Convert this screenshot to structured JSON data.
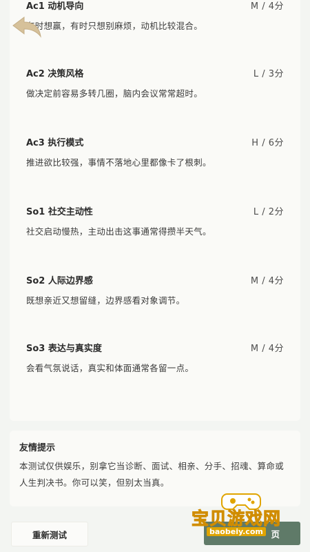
{
  "dimensions": [
    {
      "title": "Ac1 动机导向",
      "score": "M / 4分",
      "desc": "有时想赢，有时只想别麻烦，动机比较混合。"
    },
    {
      "title": "Ac2 决策风格",
      "score": "L / 3分",
      "desc": "做决定前容易多转几圈，脑内会议常常超时。"
    },
    {
      "title": "Ac3 执行模式",
      "score": "H / 6分",
      "desc": "推进欲比较强，事情不落地心里都像卡了根刺。"
    },
    {
      "title": "So1 社交主动性",
      "score": "L / 2分",
      "desc": "社交启动慢热，主动出击这事通常得攒半天气。"
    },
    {
      "title": "So2 人际边界感",
      "score": "M / 4分",
      "desc": "既想亲近又想留缝，边界感看对象调节。"
    },
    {
      "title": "So3 表达与真实度",
      "score": "M / 4分",
      "desc": "会看气氛说话，真实和体面通常各留一点。"
    }
  ],
  "tip": {
    "title": "友情提示",
    "body": "本测试仅供娱乐，别拿它当诊断、面试、相亲、分手、招魂、算命或人生判决书。你可以笑，但别太当真。"
  },
  "buttons": {
    "retest": "重新测试",
    "share": "页"
  },
  "watermark": {
    "text": "宝贝游戏网",
    "url": "baobeiy.com"
  },
  "colors": {
    "accent": "#5f7a68",
    "back_arrow": "#d6c19a"
  }
}
